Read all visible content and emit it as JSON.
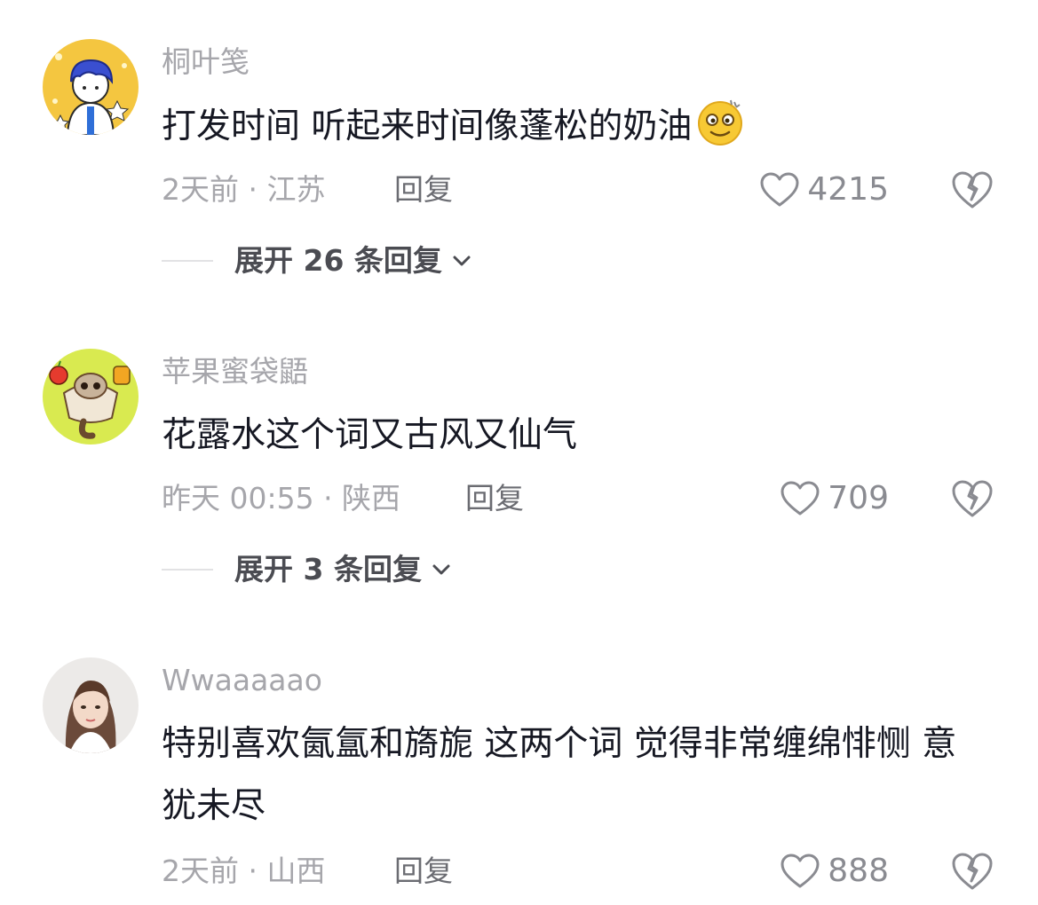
{
  "comments": [
    {
      "username": "桐叶笺",
      "text": "打发时间 听起来时间像蓬松的奶油",
      "emoji": "dizzy-face-emoji",
      "time_location": "2天前 · 江苏",
      "reply_label": "回复",
      "likes": "4215",
      "expand_label": "展开 26 条回复"
    },
    {
      "username": "苹果蜜袋鼯",
      "text": "花露水这个词又古风又仙气",
      "time_location": "昨天 00:55 · 陕西",
      "reply_label": "回复",
      "likes": "709",
      "expand_label": "展开 3 条回复"
    },
    {
      "username": "Wwaaaaao",
      "text": "特别喜欢氤氲和旖旎 这两个词 觉得非常缠绵悱恻 意犹未尽",
      "time_location": "2天前 · 山西",
      "reply_label": "回复",
      "likes": "888"
    }
  ],
  "icons": {
    "like": "heart-outline-icon",
    "dislike": "broken-heart-icon",
    "expand": "chevron-down-icon"
  },
  "colors": {
    "username": "#a6a6ab",
    "text": "#161823",
    "meta": "#a6a6ab",
    "reply": "#6b6c72"
  }
}
